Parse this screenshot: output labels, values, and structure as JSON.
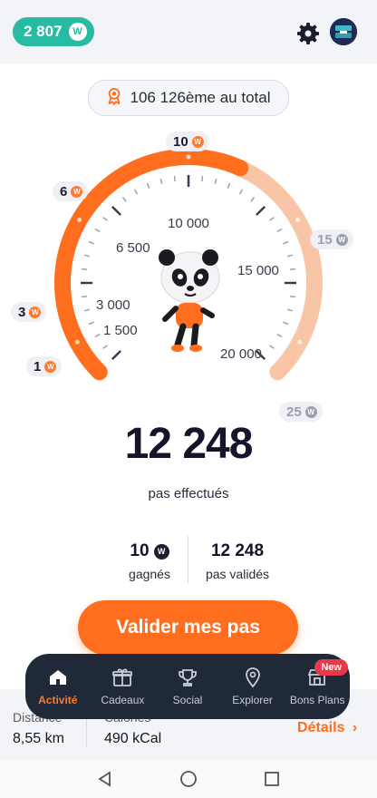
{
  "header": {
    "balance": "2 807",
    "coin_symbol": "W"
  },
  "rank": {
    "label": "106 126ème au total"
  },
  "milestones": {
    "m1": "1",
    "m3": "3",
    "m6": "6",
    "m10": "10",
    "m15": "15",
    "m25": "25"
  },
  "gauge": {
    "labels": {
      "l1500": "1 500",
      "l3000": "3 000",
      "l6500": "6 500",
      "l10000": "10 000",
      "l15000": "15 000",
      "l20000": "20 000"
    },
    "progress_fraction": 0.59,
    "colors": {
      "active": "#ff6e1f",
      "inactive": "#f8c6a6"
    }
  },
  "steps": {
    "value": "12 248",
    "label": "pas effectués"
  },
  "stats": {
    "earned_value": "10",
    "earned_label": "gagnés",
    "validated_value": "12 248",
    "validated_label": "pas validés"
  },
  "cta": {
    "label": "Valider mes pas"
  },
  "summary": {
    "distance_label": "Distance",
    "distance_value": "8,55 km",
    "calories_label": "Calories",
    "calories_value": "490 kCal",
    "details_label": "Détails"
  },
  "nav": {
    "items": [
      {
        "label": "Activité",
        "icon": "home-icon"
      },
      {
        "label": "Cadeaux",
        "icon": "gift-icon"
      },
      {
        "label": "Social",
        "icon": "trophy-icon"
      },
      {
        "label": "Explorer",
        "icon": "map-pin-icon"
      },
      {
        "label": "Bons Plans",
        "icon": "store-icon"
      }
    ],
    "new_badge": "New"
  },
  "colors": {
    "accent": "#ff6e1f",
    "teal": "#27bba3",
    "nav_bg": "#1f2937"
  }
}
